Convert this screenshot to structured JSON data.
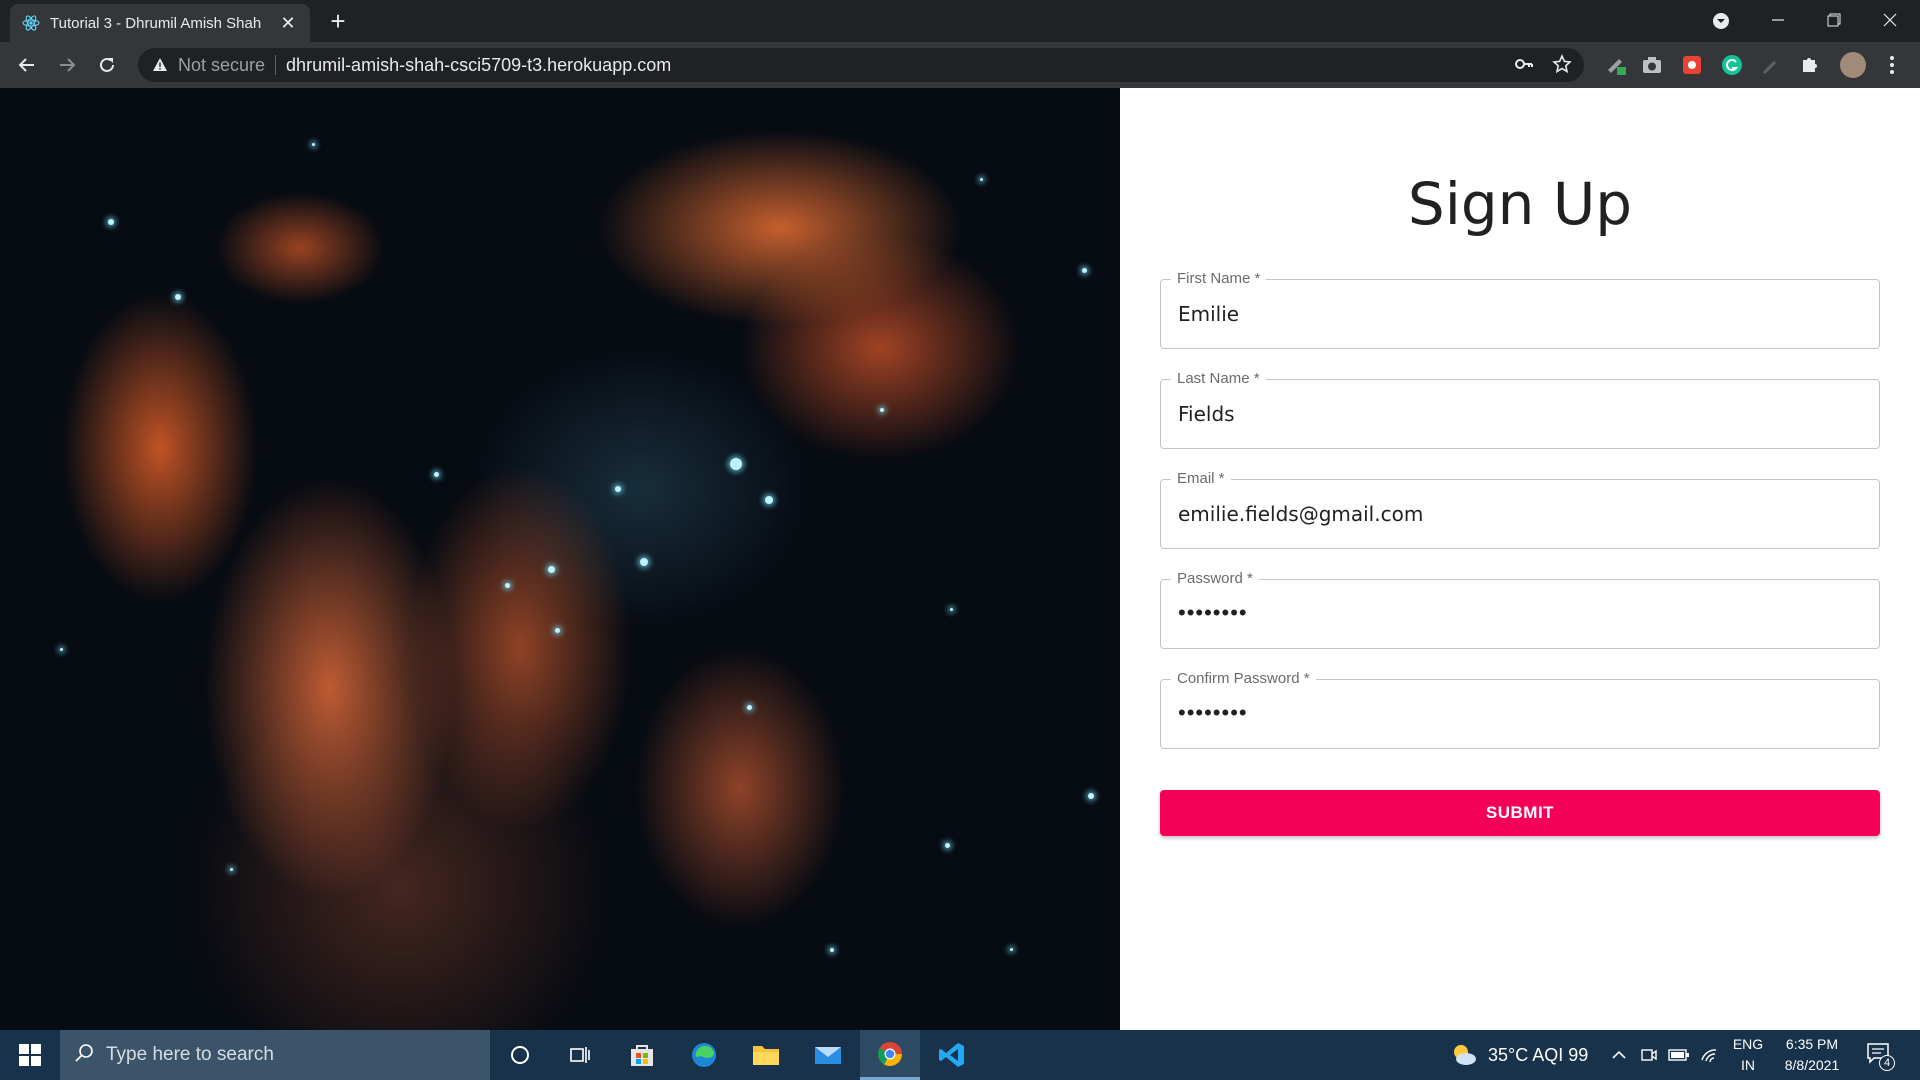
{
  "browser": {
    "tab_title": "Tutorial 3 - Dhrumil Amish Shah",
    "security_label": "Not secure",
    "url": "dhrumil-amish-shah-csci5709-t3.herokuapp.com"
  },
  "form": {
    "title": "Sign Up",
    "fields": [
      {
        "label": "First Name *",
        "value": "Emilie"
      },
      {
        "label": "Last Name *",
        "value": "Fields"
      },
      {
        "label": "Email *",
        "value": "emilie.fields@gmail.com"
      },
      {
        "label": "Password *",
        "value": "••••••••"
      },
      {
        "label": "Confirm Password *",
        "value": "••••••••"
      }
    ],
    "submit_label": "SUBMIT",
    "accent_color": "#f50057"
  },
  "taskbar": {
    "search_placeholder": "Type here to search",
    "weather": "35°C  AQI 99",
    "language": "ENG",
    "region": "IN",
    "time": "6:35 PM",
    "date": "8/8/2021",
    "notification_count": "4"
  }
}
